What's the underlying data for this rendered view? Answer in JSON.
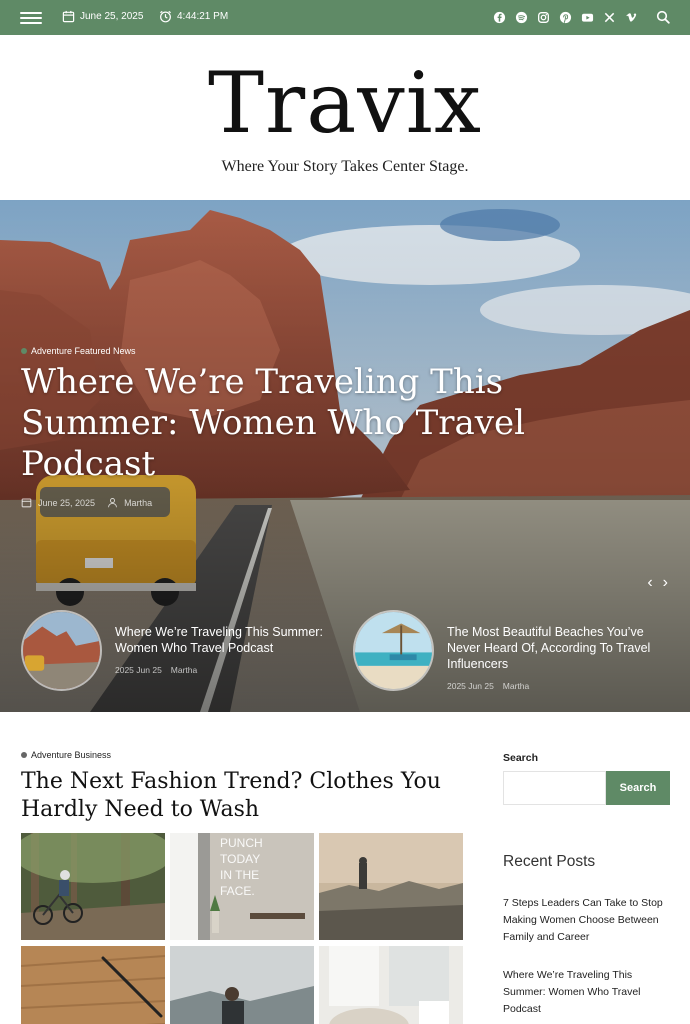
{
  "topbar": {
    "date": "June 25, 2025",
    "time": "4:44:21 PM",
    "social_icons": [
      "facebook-icon",
      "spotify-icon",
      "instagram-icon",
      "pinterest-icon",
      "youtube-icon",
      "x-icon",
      "vimeo-icon"
    ],
    "accent": "#5f8a66"
  },
  "brand": {
    "title": "Travix",
    "tagline": "Where Your Story Takes Center Stage."
  },
  "hero": {
    "categories": "Adventure Featured News",
    "headline": "Where We’re Traveling This Summer: Women Who Travel Podcast",
    "date": "June 25, 2025",
    "author": "Martha",
    "cards": [
      {
        "title": "Where We’re Traveling This Summer: Women Who Travel Podcast",
        "date": "2025 Jun 25",
        "author": "Martha"
      },
      {
        "title": "The Most Beautiful Beaches You’ve Never Heard Of, According To Travel Influencers",
        "date": "2025 Jun 25",
        "author": "Martha"
      }
    ]
  },
  "article": {
    "categories": "Adventure Business",
    "title": "The Next Fashion Trend? Clothes You Hardly Need to Wash"
  },
  "sidebar": {
    "search_label": "Search",
    "search_placeholder": "",
    "search_button": "Search",
    "recent_title": "Recent Posts",
    "recent_posts": [
      "7 Steps Leaders Can Take to Stop Making Women Choose Between Family and Career",
      "Where We’re Traveling This Summer: Women Who Travel Podcast"
    ]
  }
}
